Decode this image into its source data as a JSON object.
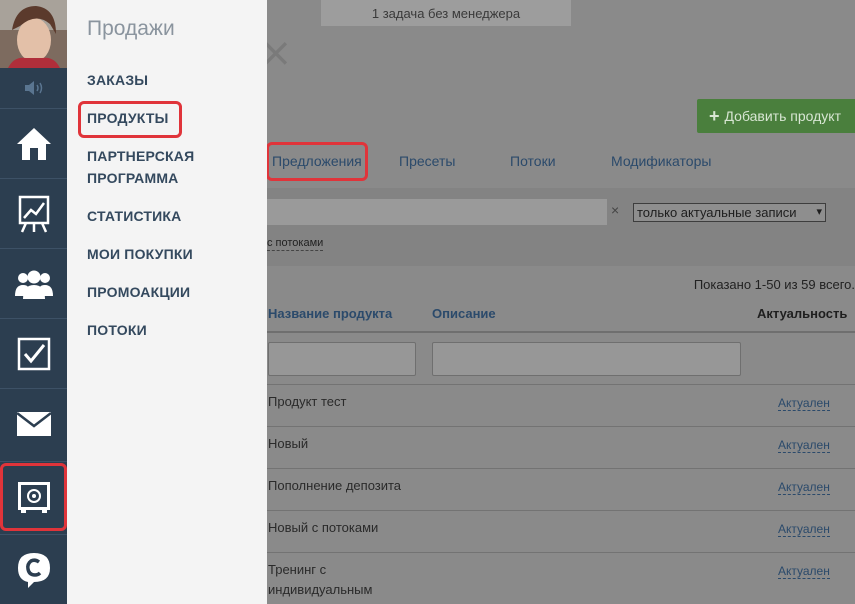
{
  "colors": {
    "rail_bg": "#2c3e50",
    "menu_bg": "#f4f4f4",
    "highlight": "#e0343a",
    "add_button": "#4a7f3d",
    "link": "#2b4a6b"
  },
  "rail": {
    "icons": [
      "speaker-icon",
      "home-icon",
      "chart-icon",
      "users-icon",
      "tasks-icon",
      "mail-icon",
      "sales-safe-icon",
      "chat-c-icon"
    ],
    "active": "sales-safe-icon"
  },
  "menu": {
    "title": "Продажи",
    "items": [
      {
        "label": "ЗАКАЗЫ"
      },
      {
        "label": "ПРОДУКТЫ",
        "highlighted": true
      },
      {
        "label": "ПАРТНЕРСКАЯ\nПРОГРАММА"
      },
      {
        "label": "СТАТИСТИКА"
      },
      {
        "label": "МОИ ПОКУПКИ"
      },
      {
        "label": "ПРОМОАКЦИИ"
      },
      {
        "label": "ПОТОКИ"
      }
    ]
  },
  "main": {
    "notice": "1 задача без менеджера",
    "add_button_label": "Добавить продукт",
    "tabs": [
      {
        "label": "Предложения",
        "highlighted": true
      },
      {
        "label": "Пресеты"
      },
      {
        "label": "Потоки"
      },
      {
        "label": "Модификаторы"
      }
    ],
    "filter": {
      "clear": "×",
      "select_value": "только актуальные записи",
      "flows_link": "с потоками"
    },
    "shown_text": "Показано 1-50 из 59 всего.",
    "table": {
      "headers": [
        "Название продукта",
        "Описание",
        "Актуальность"
      ],
      "rows": [
        {
          "name": "Продукт тест",
          "status": "Актуален"
        },
        {
          "name": "Новый",
          "status": "Актуален"
        },
        {
          "name": "Пополнение депозита",
          "status": "Актуален"
        },
        {
          "name": "Новый с потоками",
          "status": "Актуален"
        },
        {
          "name": "Тренинг с\nиндивидуальным",
          "status": "Актуален"
        }
      ]
    }
  }
}
